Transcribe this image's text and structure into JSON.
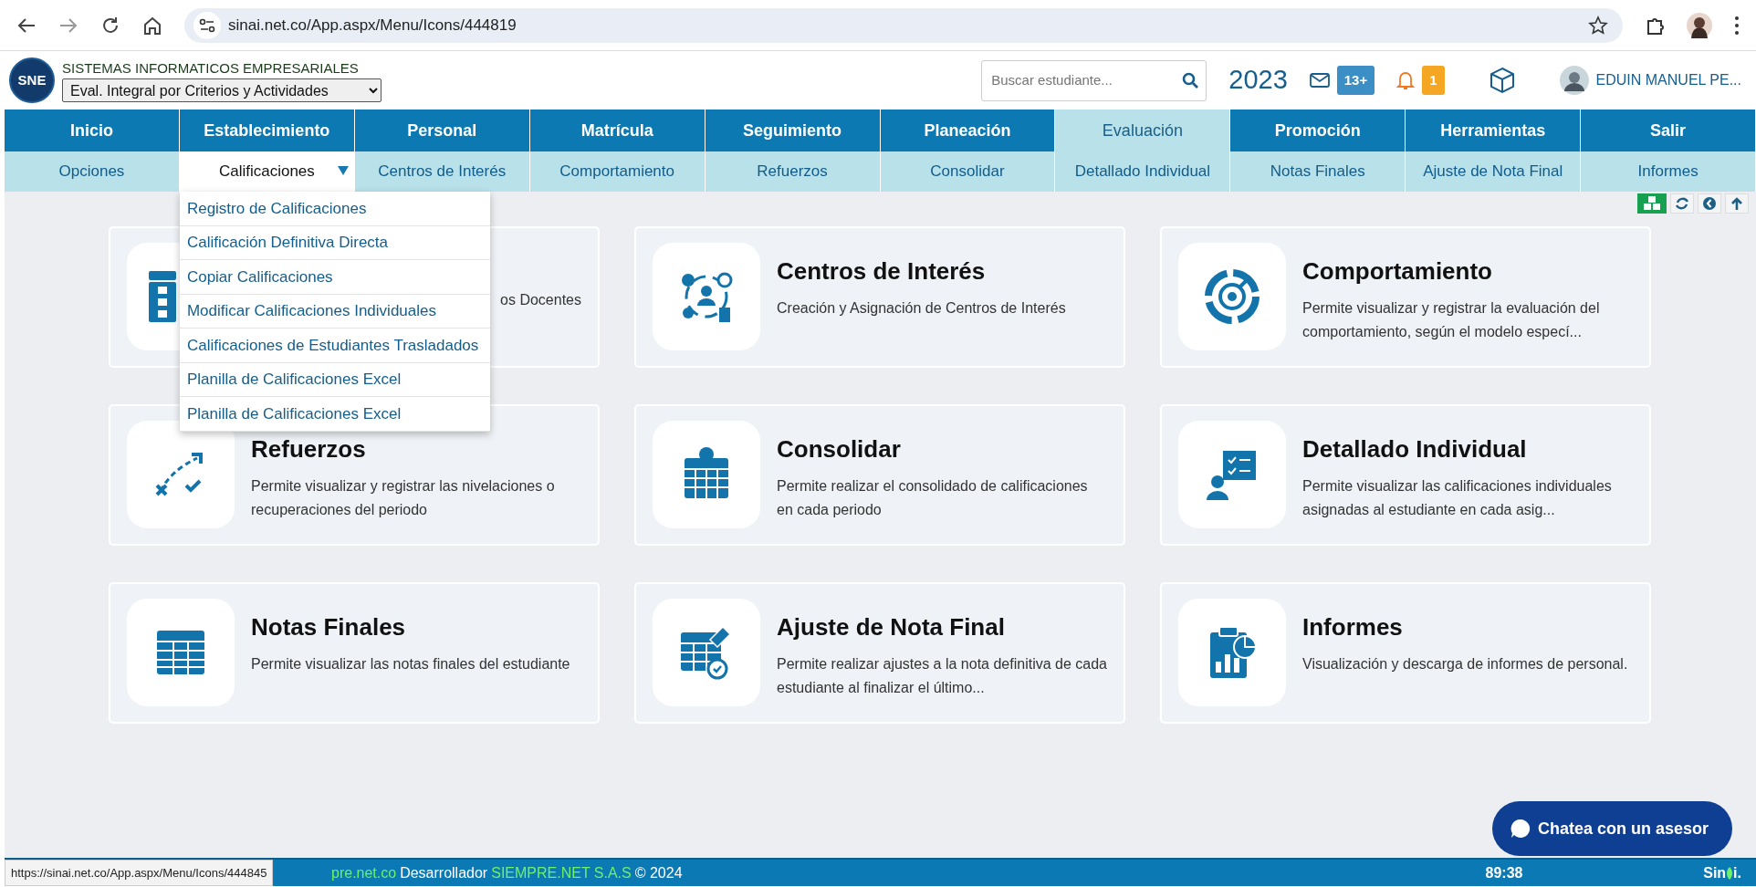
{
  "browser": {
    "url": "sinai.net.co/App.aspx/Menu/Icons/444819",
    "status_url": "https://sinai.net.co/App.aspx/Menu/Icons/444845"
  },
  "header": {
    "logo_text": "SNE",
    "company": "SISTEMAS INFORMATICOS EMPRESARIALES",
    "program": "Eval. Integral por Criterios y Actividades",
    "search_placeholder": "Buscar estudiante...",
    "year": "2023",
    "messages_badge": "13+",
    "alerts_badge": "1",
    "user_name": "EDUIN MANUEL PE..."
  },
  "nav": [
    {
      "label": "Inicio",
      "selected": false
    },
    {
      "label": "Establecimiento",
      "selected": false
    },
    {
      "label": "Personal",
      "selected": false
    },
    {
      "label": "Matrícula",
      "selected": false
    },
    {
      "label": "Seguimiento",
      "selected": false
    },
    {
      "label": "Planeación",
      "selected": false
    },
    {
      "label": "Evaluación",
      "selected": true
    },
    {
      "label": "Promoción",
      "selected": false
    },
    {
      "label": "Herramientas",
      "selected": false
    },
    {
      "label": "Salir",
      "selected": false
    }
  ],
  "subnav": [
    {
      "label": "Opciones",
      "selected": false
    },
    {
      "label": "Calificaciones",
      "selected": true
    },
    {
      "label": "Centros de Interés",
      "selected": false
    },
    {
      "label": "Comportamiento",
      "selected": false
    },
    {
      "label": "Refuerzos",
      "selected": false
    },
    {
      "label": "Consolidar",
      "selected": false
    },
    {
      "label": "Detallado Individual",
      "selected": false
    },
    {
      "label": "Notas Finales",
      "selected": false
    },
    {
      "label": "Ajuste de Nota Final",
      "selected": false
    },
    {
      "label": "Informes",
      "selected": false
    }
  ],
  "dropdown": [
    "Registro de Calificaciones",
    "Calificación Definitiva Directa",
    "Copiar Calificaciones",
    "Modificar Calificaciones Individuales",
    "Calificaciones de Estudiantes Trasladados",
    "Planilla de Calificaciones Excel",
    "Planilla de Calificaciones Excel"
  ],
  "cards": [
    {
      "description": "os Docentes"
    },
    {
      "title": "Centros de Interés",
      "description": "Creación y Asignación de Centros de Interés"
    },
    {
      "title": "Comportamiento",
      "description": "Permite visualizar y registrar la evaluación del comportamiento, según el modelo especí..."
    },
    {
      "title": "Refuerzos",
      "description": "Permite visualizar y registrar las nivelaciones o recuperaciones del periodo"
    },
    {
      "title": "Consolidar",
      "description": "Permite realizar el consolidado de calificaciones en cada periodo"
    },
    {
      "title": "Detallado Individual",
      "description": "Permite visualizar las calificaciones individuales asignadas al estudiante en cada asig..."
    },
    {
      "title": "Notas Finales",
      "description": "Permite visualizar las notas finales del estudiante"
    },
    {
      "title": "Ajuste de Nota Final",
      "description": "Permite realizar ajustes a la nota definitiva de cada estudiante al finalizar el último..."
    },
    {
      "title": "Informes",
      "description": "Visualización y descarga de informes de personal."
    }
  ],
  "chat": {
    "label": "Chatea con un asesor"
  },
  "footer": {
    "site": "pre.net.co",
    "developer_label": "Desarrollador",
    "developer": "SIEMPRE.NET S.A.S",
    "copyright": "© 2024",
    "timer": "89:38",
    "logo_start": "Sin",
    "logo_end": "i."
  }
}
